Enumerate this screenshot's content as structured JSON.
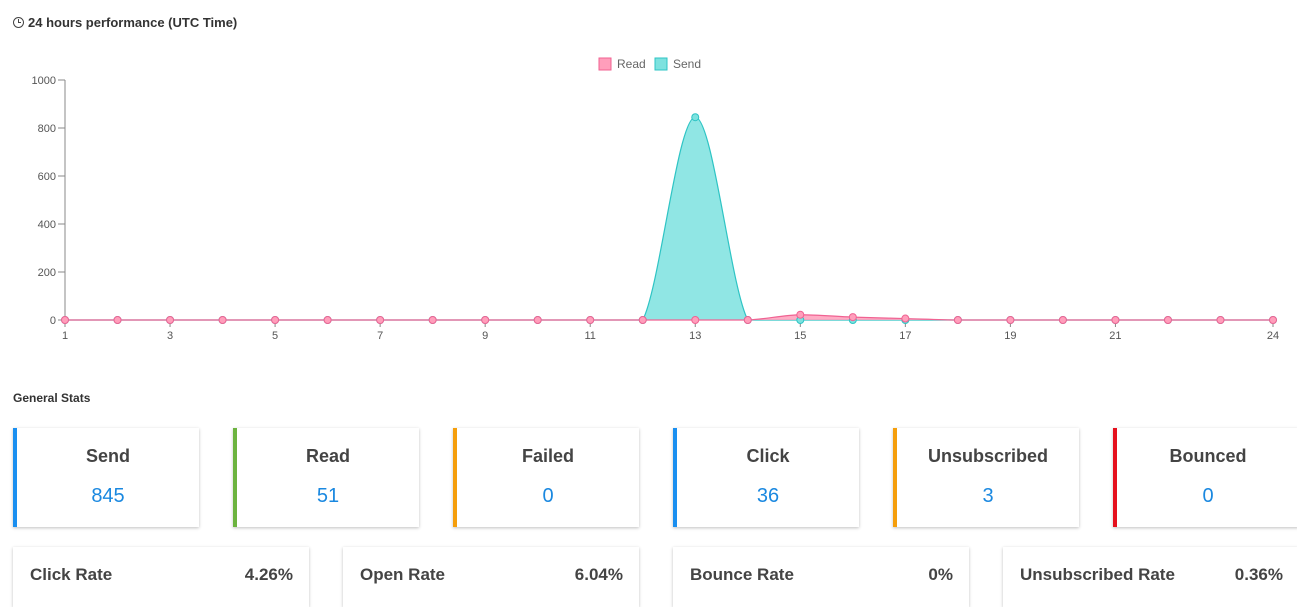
{
  "header": {
    "title": "24 hours performance (UTC Time)",
    "icon": "clock-icon"
  },
  "chart_data": {
    "type": "area",
    "title": "24 hours performance (UTC Time)",
    "xlabel": "",
    "ylabel": "",
    "x": [
      1,
      2,
      3,
      4,
      5,
      6,
      7,
      8,
      9,
      10,
      11,
      12,
      13,
      14,
      15,
      16,
      17,
      18,
      19,
      20,
      21,
      22,
      23,
      24
    ],
    "x_tick_labels": [
      "1",
      "3",
      "5",
      "7",
      "9",
      "11",
      "13",
      "15",
      "17",
      "19",
      "21",
      "24"
    ],
    "x_tick_values": [
      1,
      3,
      5,
      7,
      9,
      11,
      13,
      15,
      17,
      19,
      21,
      24
    ],
    "y_tick_labels": [
      "0",
      "200",
      "400",
      "600",
      "800",
      "1000"
    ],
    "ylim": [
      0,
      1000
    ],
    "xlim": [
      1,
      24
    ],
    "grid": false,
    "legend": "top-center",
    "series": [
      {
        "name": "Read",
        "color": "#f06292",
        "fill": "#ff9ebb",
        "values": [
          0,
          0,
          0,
          0,
          0,
          0,
          0,
          0,
          0,
          0,
          0,
          0,
          0,
          0,
          22,
          12,
          6,
          0,
          0,
          0,
          0,
          0,
          0,
          0
        ]
      },
      {
        "name": "Send",
        "color": "#2ec4c4",
        "fill": "#7de2df",
        "values": [
          0,
          0,
          0,
          0,
          0,
          0,
          0,
          0,
          0,
          0,
          0,
          0,
          845,
          0,
          0,
          0,
          0,
          0,
          0,
          0,
          0,
          0,
          0,
          0
        ]
      }
    ]
  },
  "general_stats": {
    "title": "General Stats",
    "cards": [
      {
        "label": "Send",
        "value": "845",
        "color": "#1a8ff0"
      },
      {
        "label": "Read",
        "value": "51",
        "color": "#6cb33f"
      },
      {
        "label": "Failed",
        "value": "0",
        "color": "#f59e0b"
      },
      {
        "label": "Click",
        "value": "36",
        "color": "#1a8ff0"
      },
      {
        "label": "Unsubscribed",
        "value": "3",
        "color": "#f59e0b"
      },
      {
        "label": "Bounced",
        "value": "0",
        "color": "#e5101d"
      }
    ],
    "rates": [
      {
        "label": "Click Rate",
        "value": "4.26%"
      },
      {
        "label": "Open Rate",
        "value": "6.04%"
      },
      {
        "label": "Bounce Rate",
        "value": "0%"
      },
      {
        "label": "Unsubscribed Rate",
        "value": "0.36%"
      }
    ]
  }
}
